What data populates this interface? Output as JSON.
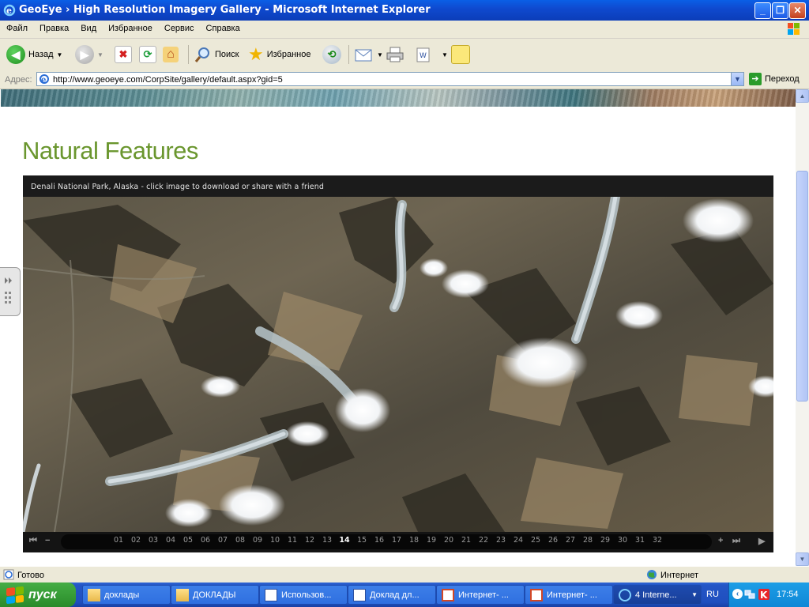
{
  "window": {
    "title": "GeoEye › High Resolution Imagery Gallery - Microsoft Internet Explorer",
    "buttons": [
      "_",
      "❐",
      "✕"
    ]
  },
  "menu": [
    "Файл",
    "Правка",
    "Вид",
    "Избранное",
    "Сервис",
    "Справка"
  ],
  "toolbar": {
    "back_label": "Назад",
    "search_label": "Поиск",
    "favorites_label": "Избранное"
  },
  "address": {
    "label": "Адрес:",
    "url": "http://www.geoeye.com/CorpSite/gallery/default.aspx?gid=5",
    "go_label": "Переход"
  },
  "page": {
    "title": "Natural Features",
    "caption": "Denali National Park, Alaska - click image to download or share with a friend",
    "pages": [
      "01",
      "02",
      "03",
      "04",
      "05",
      "06",
      "07",
      "08",
      "09",
      "10",
      "11",
      "12",
      "13",
      "14",
      "15",
      "16",
      "17",
      "18",
      "19",
      "20",
      "21",
      "22",
      "23",
      "24",
      "25",
      "26",
      "27",
      "28",
      "29",
      "30",
      "31",
      "32"
    ],
    "current_page": "14",
    "controls": {
      "first": "⏮",
      "minus": "−",
      "plus": "+",
      "last": "⏭",
      "play": "▶"
    }
  },
  "status": {
    "text": "Готово",
    "zone": "Интернет"
  },
  "taskbar": {
    "start_label": "пуск",
    "tasks": [
      {
        "label": "доклады",
        "icon": "folder-icon"
      },
      {
        "label": "ДОКЛАДЫ",
        "icon": "folder-icon"
      },
      {
        "label": "Использов...",
        "icon": "word-doc-icon"
      },
      {
        "label": "Доклад дл...",
        "icon": "word-doc-icon"
      },
      {
        "label": "Интернет- ...",
        "icon": "powerpoint-icon"
      },
      {
        "label": "Интернет- ...",
        "icon": "powerpoint-icon"
      },
      {
        "label": "4 Interne...",
        "icon": "ie-icon"
      }
    ],
    "language": "RU",
    "clock": "17:54"
  },
  "colors": {
    "title_green": "#6a962e",
    "xp_blue": "#0f4ad0",
    "start_green": "#379d37"
  }
}
